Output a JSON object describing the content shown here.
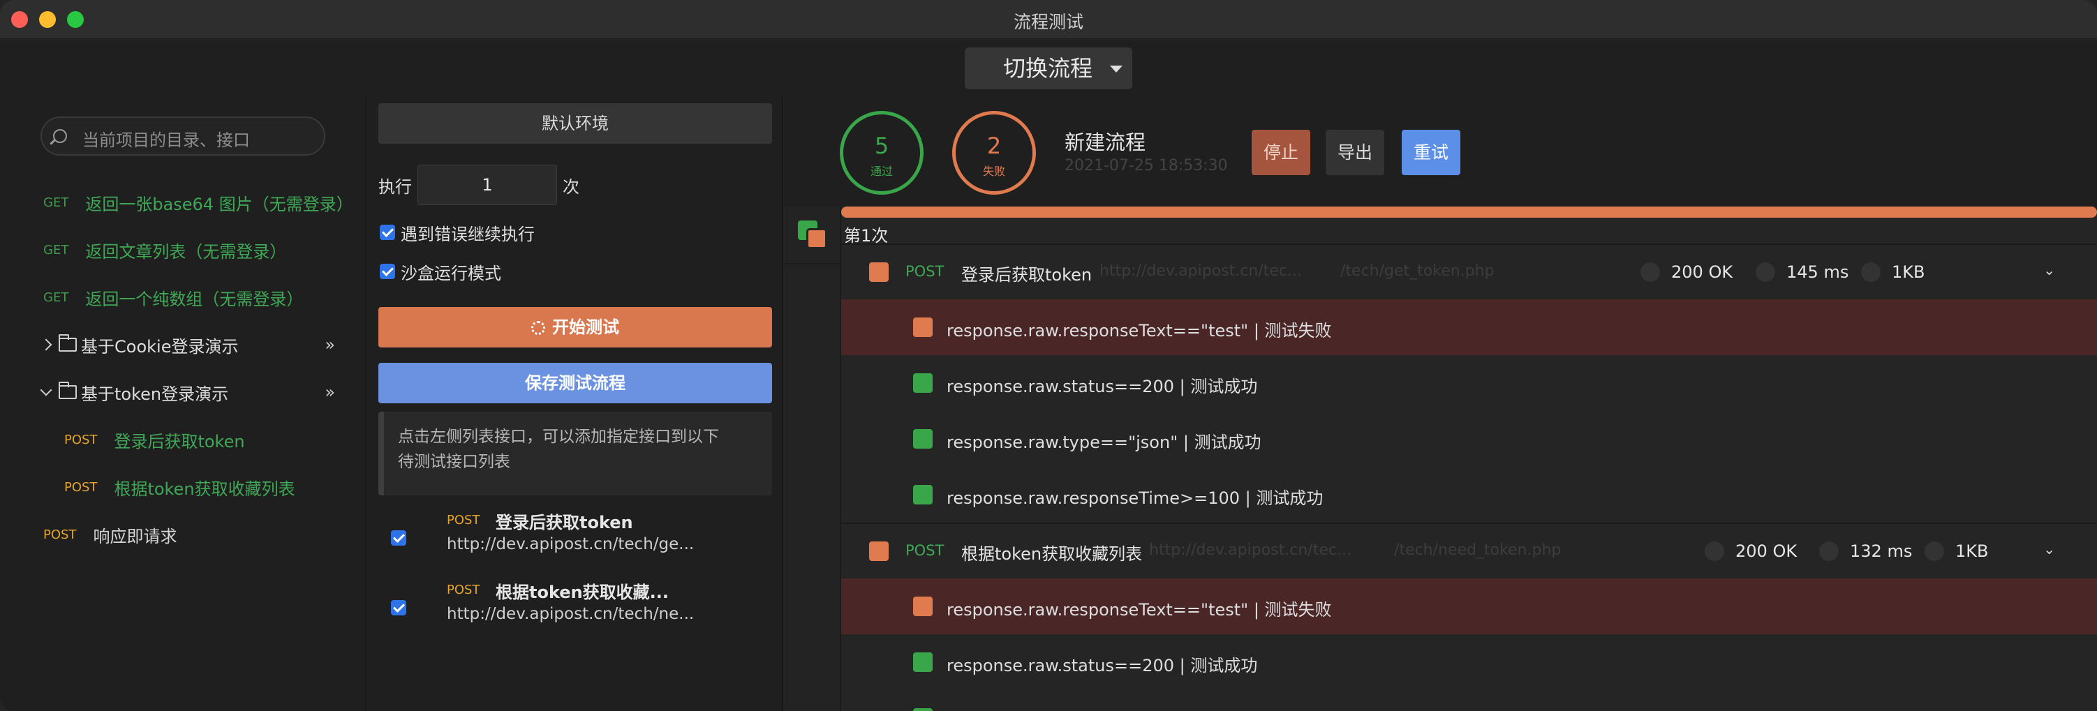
{
  "window": {
    "title": "流程测试"
  },
  "topbar": {
    "switch_flow_label": "切换流程"
  },
  "sidebar": {
    "search_placeholder": "当前项目的目录、接口",
    "items": [
      {
        "method": "GET",
        "label": "返回一张base64 图片（无需登录）"
      },
      {
        "method": "GET",
        "label": "返回文章列表（无需登录）"
      },
      {
        "method": "GET",
        "label": "返回一个纯数组（无需登录）"
      }
    ],
    "folders": [
      {
        "label": "基于Cookie登录演示",
        "expanded": false
      },
      {
        "label": "基于token登录演示",
        "expanded": true
      }
    ],
    "folder_items": [
      {
        "method": "POST",
        "label": "登录后获取token"
      },
      {
        "method": "POST",
        "label": "根据token获取收藏列表"
      }
    ],
    "root_item": {
      "method": "POST",
      "label": "响应即请求"
    },
    "expand_glyph": "»"
  },
  "middle": {
    "env_label": "默认环境",
    "exec_prefix": "执行",
    "exec_count": "1",
    "exec_suffix": "次",
    "continue_on_error": "遇到错误继续执行",
    "sandbox_mode": "沙盒运行模式",
    "start_label": "开始测试",
    "save_label": "保存测试流程",
    "hint_line1": "点击左侧列表接口，可以添加指定接口到以下",
    "hint_line2": "待测试接口列表",
    "flow_items": [
      {
        "method": "POST",
        "name": "登录后获取token",
        "url": "http://dev.apipost.cn/tech/ge..."
      },
      {
        "method": "POST",
        "name": "根据token获取收藏...",
        "url": "http://dev.apipost.cn/tech/ne..."
      }
    ]
  },
  "summary": {
    "pass_count": "5",
    "pass_label": "通过",
    "fail_count": "2",
    "fail_label": "失败",
    "flow_name": "新建流程",
    "flow_time": "2021-07-25 18:53:30",
    "stop_label": "停止",
    "export_label": "导出",
    "retry_label": "重试"
  },
  "results": {
    "round_label": "第1次",
    "requests": [
      {
        "method": "POST",
        "name": "登录后获取token",
        "url_prefix": "http://dev.apipost.cn/tec...",
        "url_suffix": "/tech/get_token.php",
        "status": "200 OK",
        "time": "145 ms",
        "size": "1KB",
        "assertions": [
          {
            "text": "response.raw.responseText==\"test\" | 测试失败",
            "passed": false
          },
          {
            "text": "response.raw.status==200 | 测试成功",
            "passed": true
          },
          {
            "text": "response.raw.type==\"json\" | 测试成功",
            "passed": true
          },
          {
            "text": "response.raw.responseTime>=100 | 测试成功",
            "passed": true
          }
        ]
      },
      {
        "method": "POST",
        "name": "根据token获取收藏列表",
        "url_prefix": "http://dev.apipost.cn/tec...",
        "url_suffix": "/tech/need_token.php",
        "status": "200 OK",
        "time": "132 ms",
        "size": "1KB",
        "assertions": [
          {
            "text": "response.raw.responseText==\"test\" | 测试失败",
            "passed": false
          },
          {
            "text": "response.raw.status==200 | 测试成功",
            "passed": true
          }
        ]
      }
    ],
    "chevron_glyph": "⌄"
  },
  "colors": {
    "pass": "#3aa64a",
    "fail": "#e07a4f",
    "primary": "#6b92e0",
    "get": "#3f9b4f",
    "post": "#e8a52b"
  }
}
